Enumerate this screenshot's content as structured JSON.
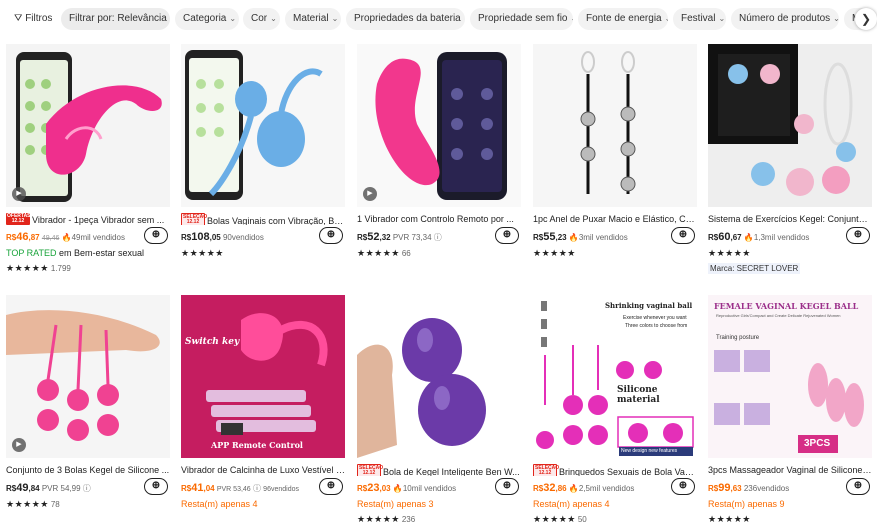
{
  "filters": [
    {
      "label": "Filtros"
    },
    {
      "label": "Filtrar por: Relevância"
    },
    {
      "label": "Categoria"
    },
    {
      "label": "Cor"
    },
    {
      "label": "Material"
    },
    {
      "label": "Propriedades da bateria"
    },
    {
      "label": "Propriedade sem fio"
    },
    {
      "label": "Fonte de energia"
    },
    {
      "label": "Festival"
    },
    {
      "label": "Número de produtos"
    },
    {
      "label": "Mo"
    }
  ],
  "chevron": "⌄",
  "scroll_next": "❯",
  "cart_icon": "🛒",
  "products": [
    {
      "badge": "OFERTAS 12.12",
      "badge_style": "red",
      "title": "Vibrador - 1peça Vibrador sem ...",
      "currency": "R$",
      "price_int": "46",
      "price_dec": ",87",
      "old_price": "49,46",
      "sold": "49mil vendidos",
      "extra": "TOP RATED",
      "extra_rest": " em Bem-estar sexual",
      "stars": "★★★★★",
      "count": "1.799",
      "has_video": true
    },
    {
      "badge": "SELEÇÃO 12.12",
      "badge_style": "pink",
      "title": "Bolas Vaginais com Vibração, Bo...",
      "currency": "R$",
      "price_int": "108",
      "price_dec": ",05",
      "sold": "90vendidos",
      "stars": "★★★★★",
      "count": ""
    },
    {
      "title": "1 Vibrador com Controlo Remoto por ...",
      "currency": "R$",
      "price_int": "52",
      "price_dec": ",32",
      "pvr": "PVR 73,34",
      "stars": "★★★★★",
      "count": "66",
      "has_video": true
    },
    {
      "title": "1pc Anel de Puxar Macio e Elástico, Co...",
      "currency": "R$",
      "price_int": "55",
      "price_dec": ",23",
      "sold": "3mil vendidos",
      "stars": "★★★★★",
      "count": ""
    },
    {
      "title": "Sistema de Exercícios Kegel: Conjunto ...",
      "currency": "R$",
      "price_int": "60",
      "price_dec": ",67",
      "sold": "1,3mil vendidos",
      "stars": "★★★★★",
      "count": "",
      "brand": "Marca: SECRET LOVER"
    },
    {
      "title": "Conjunto de 3 Bolas Kegel de Silicone ...",
      "currency": "R$",
      "price_int": "49",
      "price_dec": ",84",
      "pvr": "PVR 54,99",
      "stars": "★★★★★",
      "count": "78",
      "has_video": true
    },
    {
      "title": "Vibrador de Calcinha de Luxo Vestível -...",
      "currency": "R$",
      "price_int": "41",
      "price_dec": ",04",
      "pvr": "PVR 53,46",
      "sold": "96vendidos",
      "extra": "Resta(m) apenas 4",
      "orange": true
    },
    {
      "badge": "SELEÇÃO 12.12",
      "badge_style": "pink",
      "title": "Bola de Kegel Inteligente Ben W...",
      "currency": "R$",
      "price_int": "23",
      "price_dec": ",03",
      "sold": "10mil vendidos",
      "extra": "Resta(m) apenas 3",
      "stars": "★★★★★",
      "count": "236",
      "orange": true
    },
    {
      "badge": "SELEÇÃO 12.12",
      "badge_style": "pink",
      "title": "Brinquedos Sexuais de Bola Vag...",
      "currency": "R$",
      "price_int": "32",
      "price_dec": ",86",
      "sold": "2,5mil vendidos",
      "extra": "Resta(m) apenas 4",
      "stars": "★★★★★",
      "count": "50",
      "orange": true
    },
    {
      "title": "3pcs Massageador Vaginal de Silicone, ...",
      "currency": "R$",
      "price_int": "99",
      "price_dec": ",63",
      "sold": "236vendidos",
      "extra": "Resta(m) apenas 9",
      "stars": "★★★★★",
      "count": "",
      "orange": true
    }
  ],
  "image_text": {
    "p9_title": "Shrinking vaginal ball",
    "p9_sub1": "Exercise whenever you want",
    "p9_sub2": "Three colors to choose from",
    "p9_material": "Silicone material",
    "p9_new": "New design new features",
    "p10_title": "FEMALE VAGINAL KEGEL BALL",
    "p10_sub": "Reproductive Girls'Compact and Create Delicate Rejuvenated Women",
    "p10_posture": "Training posture",
    "p10_pcs": "3PCS",
    "p7_switch": "Switch key",
    "p7_remote": "APP Remote Control"
  }
}
